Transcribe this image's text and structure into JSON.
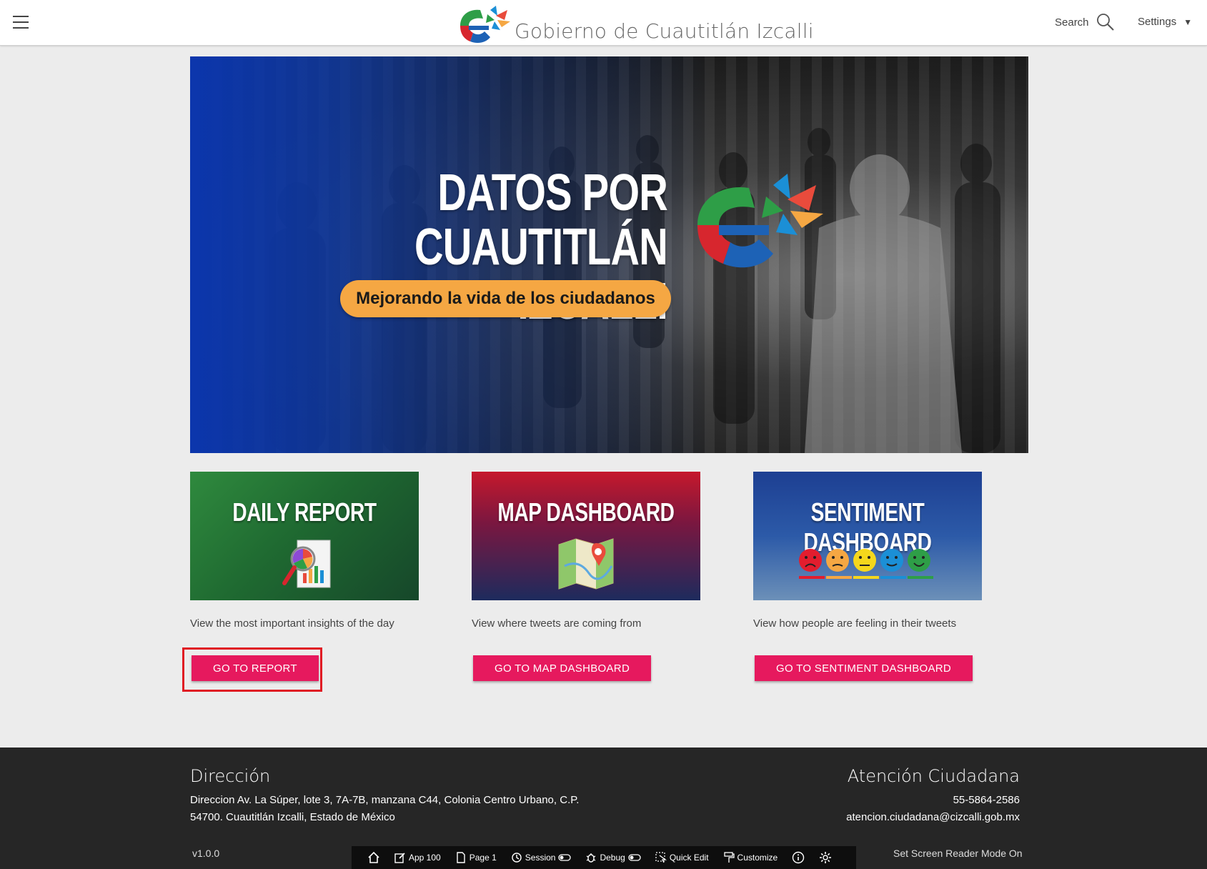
{
  "header": {
    "title": "Gobierno de Cuautitlán Izcalli",
    "search_label": "Search",
    "settings_label": "Settings",
    "settings_caret": "▼"
  },
  "hero": {
    "title_line1": "DATOS POR",
    "title_line2": "CUAUTITLÁN IZCALLI",
    "subtitle": "Mejorando la vida de los ciudadanos"
  },
  "cards": [
    {
      "title": "DAILY REPORT",
      "description": "View the most important insights of the day",
      "button": "GO TO REPORT"
    },
    {
      "title": "MAP DASHBOARD",
      "description": "View where tweets are coming from",
      "button": "GO TO MAP DASHBOARD"
    },
    {
      "title": "SENTIMENT DASHBOARD",
      "description": "View how people are feeling in their tweets",
      "button": "GO TO SENTIMENT DASHBOARD"
    }
  ],
  "footer": {
    "left_heading": "Dirección",
    "address_line1": "Direccion Av. La Súper, lote 3, 7A-7B, manzana C44, Colonia Centro Urbano, C.P.",
    "address_line2": "54700. Cuautitlán Izcalli, Estado de México",
    "right_heading": "Atención Ciudadana",
    "phone": "55-5864-2586",
    "email": "atencion.ciudadana@cizcalli.gob.mx",
    "version": "v1.0.0",
    "screen_reader": "Set Screen Reader Mode On"
  },
  "devbar": {
    "app": "App 100",
    "page": "Page 1",
    "session": "Session",
    "debug": "Debug",
    "quick_edit": "Quick Edit",
    "customize": "Customize"
  },
  "colors": {
    "accent_button": "#e6195e",
    "highlight_box": "#e01c24",
    "pill": "#f5a743",
    "footer_bg": "#262626"
  }
}
